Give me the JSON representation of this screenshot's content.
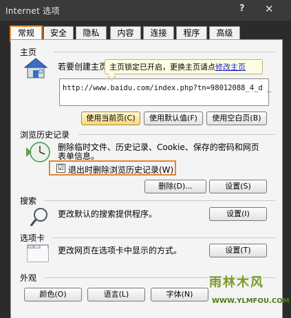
{
  "window": {
    "title": "Internet 选项",
    "help_label": "?",
    "close_label": "✕"
  },
  "tabs": [
    {
      "label": "常规",
      "active": true
    },
    {
      "label": "安全"
    },
    {
      "label": "隐私"
    },
    {
      "label": "内容"
    },
    {
      "label": "连接"
    },
    {
      "label": "程序"
    },
    {
      "label": "高级"
    }
  ],
  "homepage": {
    "section_label": "主页",
    "description": "若要创建主页",
    "url_value": "http://www.baidu.com/index.php?tn=98012088_4_d _",
    "tooltip_text": "主页锁定已开启，更换主页请点",
    "tooltip_link": "修改主页",
    "buttons": {
      "use_current": "使用当前页(C)",
      "use_default": "使用默认值(F)",
      "use_blank": "使用空白页(B)"
    }
  },
  "history": {
    "section_label": "浏览历史记录",
    "description_line1": "删除临时文件、历史记录、Cookie、保存的密码和网页",
    "description_line2": "表单信息。",
    "checkbox_label": "退出时删除浏览历史记录(W)",
    "checkbox_checked": true,
    "checkbox_mark": "☑",
    "buttons": {
      "delete": "删除(D)...",
      "settings": "设置(S)"
    }
  },
  "search": {
    "section_label": "搜索",
    "description": "更改默认的搜索提供程序。",
    "settings_button": "设置(I)"
  },
  "tabbed": {
    "section_label": "选项卡",
    "description": "更改网页在选项卡中显示的方式。",
    "settings_button": "设置(T)"
  },
  "appearance": {
    "section_label": "外观",
    "buttons": {
      "colors": "颜色(O)",
      "languages": "语言(L)",
      "fonts": "字体(N)"
    }
  },
  "watermark": {
    "text": "雨林木风",
    "url": "WWW.YLMFOU.COM"
  },
  "colors": {
    "highlight_border": "#e3842f",
    "link": "#1a1ad4",
    "tooltip_bg": "#fffde1",
    "titlebar_bg": "#3a3a3a"
  },
  "icons": {
    "homepage": "house-icon",
    "history": "clock-icon",
    "search": "magnifier-icon",
    "tabs": "tabs-icon"
  }
}
